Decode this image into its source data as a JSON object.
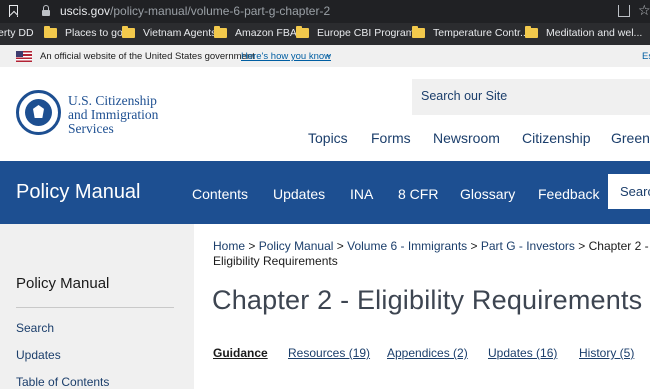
{
  "browser": {
    "url_host": "uscis.gov",
    "url_path": "/policy-manual/volume-6-part-g-chapter-2",
    "bookmarks": [
      "erty DD",
      "Places to go",
      "Vietnam Agents",
      "Amazon FBA",
      "Europe CBI Programs",
      "Temperature Contr...",
      "Meditation and wel..."
    ],
    "icons": [
      "bookmark-icon",
      "lock-icon",
      "share-icon",
      "star-icon",
      "folder-icon"
    ]
  },
  "gov_banner": {
    "official_text": "An official website of the United States government",
    "how_know_link": "Here's how you know",
    "lang_link": "Es"
  },
  "header": {
    "agency_line1": "U.S. Citizenship",
    "agency_line2": "and Immigration",
    "agency_line3": "Services",
    "search_placeholder": "Search our Site",
    "nav": [
      "Topics",
      "Forms",
      "Newsroom",
      "Citizenship",
      "Green C"
    ]
  },
  "policy_bar": {
    "title": "Policy Manual",
    "nav": [
      "Contents",
      "Updates",
      "INA",
      "8 CFR",
      "Glossary",
      "Feedback"
    ],
    "search_label": "Search"
  },
  "sidebar": {
    "title": "Policy Manual",
    "items": [
      "Search",
      "Updates",
      "Table of Contents"
    ]
  },
  "breadcrumb": {
    "items": [
      "Home",
      "Policy Manual",
      "Volume 6 - Immigrants",
      "Part G - Investors"
    ],
    "current": "Chapter 2 - Eligibility Requirements",
    "separator": ">"
  },
  "page": {
    "title": "Chapter 2 - Eligibility Requirements",
    "tabs": [
      "Guidance",
      "Resources (19)",
      "Appendices (2)",
      "Updates (16)",
      "History (5)"
    ]
  },
  "colors": {
    "uscis_blue": "#1d4f91",
    "link_blue": "#1b3e6b",
    "banner_gray": "#f0f0f0"
  }
}
